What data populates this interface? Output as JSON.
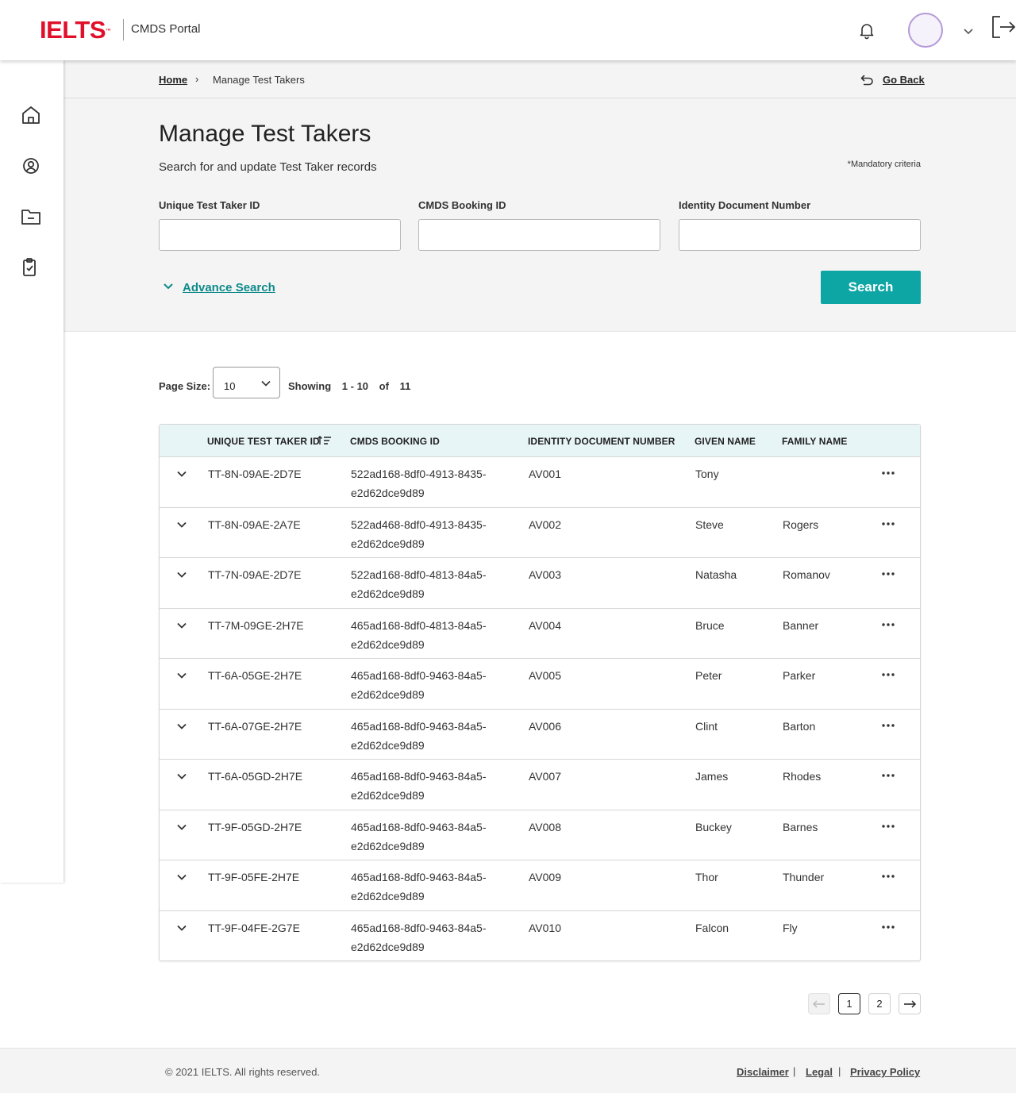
{
  "header": {
    "logo": "IELTS",
    "logo_tm": "™",
    "portal_name": "CMDS Portal"
  },
  "breadcrumb": {
    "home": "Home",
    "separator": "›",
    "current": "Manage Test Takers",
    "go_back": "Go Back"
  },
  "page": {
    "title": "Manage Test Takers",
    "subtitle": "Search for and update Test Taker records",
    "mandatory_note": "*Mandatory criteria"
  },
  "search": {
    "fields": [
      {
        "label": "Unique Test Taker ID",
        "value": ""
      },
      {
        "label": "CMDS Booking ID",
        "value": ""
      },
      {
        "label": "Identity Document Number",
        "value": ""
      }
    ],
    "advance_search": "Advance Search",
    "search_button": "Search"
  },
  "listing": {
    "page_size_label": "Page Size:",
    "page_size_value": "10",
    "showing_label": "Showing",
    "showing_range": "1 - 10",
    "of_label": "of",
    "total": "11"
  },
  "table": {
    "columns": [
      "UNIQUE TEST TAKER ID",
      "CMDS BOOKING ID",
      "IDENTITY DOCUMENT NUMBER",
      "GIVEN NAME",
      "FAMILY NAME"
    ],
    "rows": [
      {
        "id": "TT-8N-09AE-2D7E",
        "booking_1": "522ad168-8df0-4913-8435-",
        "booking_2": "e2d62dce9d89",
        "doc": "AV001",
        "given": "Tony",
        "family": ""
      },
      {
        "id": "TT-8N-09AE-2A7E",
        "booking_1": "522ad468-8df0-4913-8435-",
        "booking_2": "e2d62dce9d89",
        "doc": "AV002",
        "given": "Steve",
        "family": "Rogers"
      },
      {
        "id": "TT-7N-09AE-2D7E",
        "booking_1": "522ad168-8df0-4813-84a5-",
        "booking_2": "e2d62dce9d89",
        "doc": "AV003",
        "given": "Natasha",
        "family": "Romanov"
      },
      {
        "id": "TT-7M-09GE-2H7E",
        "booking_1": "465ad168-8df0-4813-84a5-",
        "booking_2": "e2d62dce9d89",
        "doc": "AV004",
        "given": "Bruce",
        "family": "Banner"
      },
      {
        "id": "TT-6A-05GE-2H7E",
        "booking_1": "465ad168-8df0-9463-84a5-",
        "booking_2": "e2d62dce9d89",
        "doc": "AV005",
        "given": "Peter",
        "family": "Parker"
      },
      {
        "id": "TT-6A-07GE-2H7E",
        "booking_1": "465ad168-8df0-9463-84a5-",
        "booking_2": "e2d62dce9d89",
        "doc": "AV006",
        "given": "Clint",
        "family": "Barton"
      },
      {
        "id": "TT-6A-05GD-2H7E",
        "booking_1": "465ad168-8df0-9463-84a5-",
        "booking_2": "e2d62dce9d89",
        "doc": "AV007",
        "given": "James",
        "family": "Rhodes"
      },
      {
        "id": "TT-9F-05GD-2H7E",
        "booking_1": "465ad168-8df0-9463-84a5-",
        "booking_2": "e2d62dce9d89",
        "doc": "AV008",
        "given": "Buckey",
        "family": "Barnes"
      },
      {
        "id": "TT-9F-05FE-2H7E",
        "booking_1": "465ad168-8df0-9463-84a5-",
        "booking_2": "e2d62dce9d89",
        "doc": "AV009",
        "given": "Thor",
        "family": "Thunder"
      },
      {
        "id": "TT-9F-04FE-2G7E",
        "booking_1": "465ad168-8df0-9463-84a5-",
        "booking_2": "e2d62dce9d89",
        "doc": "AV010",
        "given": "Falcon",
        "family": "Fly"
      }
    ]
  },
  "pagination": {
    "pages": [
      "1",
      "2"
    ],
    "current": "1"
  },
  "footer": {
    "copyright": "© 2021 IELTS. All rights reserved.",
    "links": [
      "Disclaimer",
      "Legal",
      "Privacy Policy"
    ],
    "separator": "|"
  },
  "colors": {
    "brand_red": "#e0102b",
    "accent_teal": "#0ea5a5",
    "table_header_bg": "#e8f5f7"
  }
}
